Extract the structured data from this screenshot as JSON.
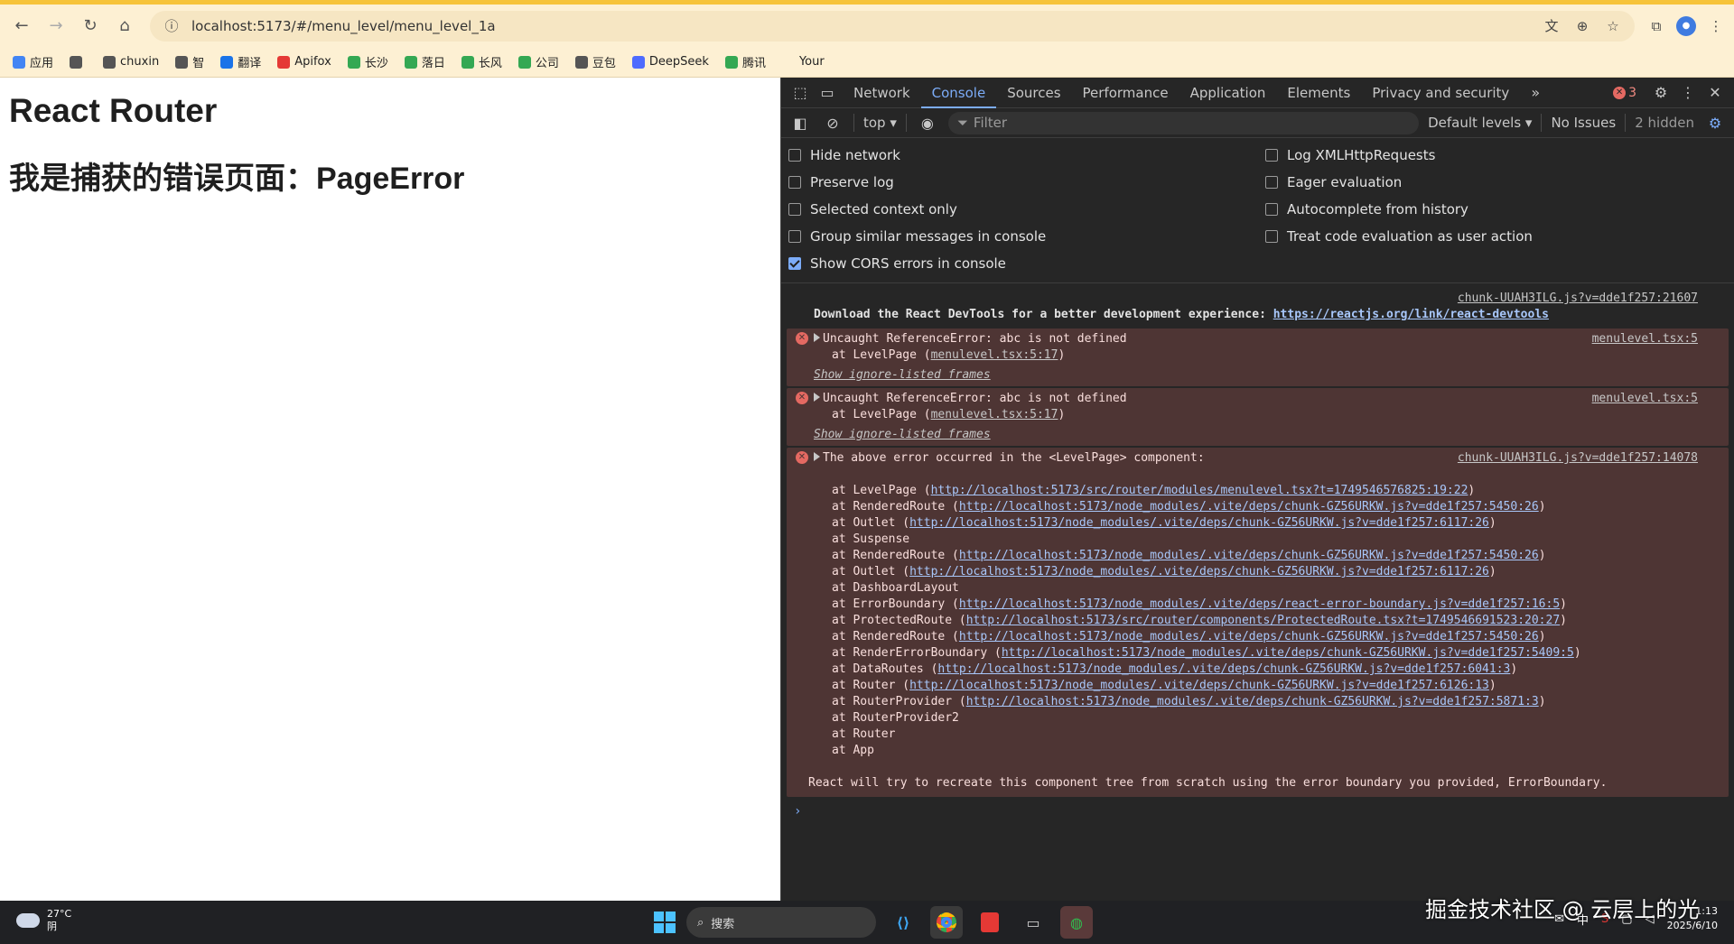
{
  "browser": {
    "url": "localhost:5173/#/menu_level/menu_level_1a",
    "bookmarks": [
      {
        "label": "应用",
        "color": "#4285f4"
      },
      {
        "label": "",
        "color": "#555555"
      },
      {
        "label": "chuxin",
        "color": "#555555"
      },
      {
        "label": "智",
        "color": "#555555"
      },
      {
        "label": "翻译",
        "color": "#1a73e8"
      },
      {
        "label": "Apifox",
        "color": "#e53935"
      },
      {
        "label": "长沙",
        "color": "#34a853"
      },
      {
        "label": "落日",
        "color": "#34a853"
      },
      {
        "label": "长风",
        "color": "#34a853"
      },
      {
        "label": "公司",
        "color": "#34a853"
      },
      {
        "label": "豆包",
        "color": "#555555"
      },
      {
        "label": "DeepSeek",
        "color": "#4d6bfe"
      },
      {
        "label": "腾讯",
        "color": "#34a853"
      },
      {
        "label": "Your",
        "color": "#fdf0d3"
      }
    ]
  },
  "page": {
    "title": "React Router",
    "subtitle": "我是捕获的错误页面：PageError"
  },
  "devtools": {
    "tabs": [
      "Network",
      "Console",
      "Sources",
      "Performance",
      "Application",
      "Elements",
      "Privacy and security"
    ],
    "active_tab": "Console",
    "error_count": "3",
    "context": "top ▾",
    "filter_placeholder": "Filter",
    "levels": "Default levels ▾",
    "issues": "No Issues",
    "hidden": "2 hidden",
    "settings_left": [
      {
        "label": "Hide network",
        "checked": false
      },
      {
        "label": "Preserve log",
        "checked": false
      },
      {
        "label": "Selected context only",
        "checked": false
      },
      {
        "label": "Group similar messages in console",
        "checked": false
      },
      {
        "label": "Show CORS errors in console",
        "checked": true
      }
    ],
    "settings_right": [
      {
        "label": "Log XMLHttpRequests",
        "checked": false
      },
      {
        "label": "Eager evaluation",
        "checked": false
      },
      {
        "label": "Autocomplete from history",
        "checked": false
      },
      {
        "label": "Treat code evaluation as user action",
        "checked": false
      }
    ],
    "info": {
      "source": "chunk-UUAH3ILG.js?v=dde1f257:21607",
      "text": "Download the React DevTools for a better development experience: ",
      "link": "https://reactjs.org/link/react-devtools"
    },
    "error1": {
      "text": "Uncaught ReferenceError: abc is not defined",
      "at_prefix": "at LevelPage (",
      "at_link": "menulevel.tsx:5:17",
      "at_suffix": ")",
      "ignore": "Show ignore-listed frames",
      "source": "menulevel.tsx:5"
    },
    "error2": {
      "text": "Uncaught ReferenceError: abc is not defined",
      "at_prefix": "at LevelPage (",
      "at_link": "menulevel.tsx:5:17",
      "at_suffix": ")",
      "ignore": "Show ignore-listed frames",
      "source": "menulevel.tsx:5"
    },
    "error3": {
      "text": "The above error occurred in the <LevelPage> component:",
      "source": "chunk-UUAH3ILG.js?v=dde1f257:14078",
      "stack": [
        {
          "prefix": "at LevelPage (",
          "link": "http://localhost:5173/src/router/modules/menulevel.tsx?t=1749546576825:19:22",
          "suffix": ")"
        },
        {
          "prefix": "at RenderedRoute (",
          "link": "http://localhost:5173/node_modules/.vite/deps/chunk-GZ56URKW.js?v=dde1f257:5450:26",
          "suffix": ")"
        },
        {
          "prefix": "at Outlet (",
          "link": "http://localhost:5173/node_modules/.vite/deps/chunk-GZ56URKW.js?v=dde1f257:6117:26",
          "suffix": ")"
        },
        {
          "prefix": "at Suspense",
          "link": "",
          "suffix": ""
        },
        {
          "prefix": "at RenderedRoute (",
          "link": "http://localhost:5173/node_modules/.vite/deps/chunk-GZ56URKW.js?v=dde1f257:5450:26",
          "suffix": ")"
        },
        {
          "prefix": "at Outlet (",
          "link": "http://localhost:5173/node_modules/.vite/deps/chunk-GZ56URKW.js?v=dde1f257:6117:26",
          "suffix": ")"
        },
        {
          "prefix": "at DashboardLayout",
          "link": "",
          "suffix": ""
        },
        {
          "prefix": "at ErrorBoundary (",
          "link": "http://localhost:5173/node_modules/.vite/deps/react-error-boundary.js?v=dde1f257:16:5",
          "suffix": ")"
        },
        {
          "prefix": "at ProtectedRoute (",
          "link": "http://localhost:5173/src/router/components/ProtectedRoute.tsx?t=1749546691523:20:27",
          "suffix": ")"
        },
        {
          "prefix": "at RenderedRoute (",
          "link": "http://localhost:5173/node_modules/.vite/deps/chunk-GZ56URKW.js?v=dde1f257:5450:26",
          "suffix": ")"
        },
        {
          "prefix": "at RenderErrorBoundary (",
          "link": "http://localhost:5173/node_modules/.vite/deps/chunk-GZ56URKW.js?v=dde1f257:5409:5",
          "suffix": ")"
        },
        {
          "prefix": "at DataRoutes (",
          "link": "http://localhost:5173/node_modules/.vite/deps/chunk-GZ56URKW.js?v=dde1f257:6041:3",
          "suffix": ")"
        },
        {
          "prefix": "at Router (",
          "link": "http://localhost:5173/node_modules/.vite/deps/chunk-GZ56URKW.js?v=dde1f257:6126:13",
          "suffix": ")"
        },
        {
          "prefix": "at RouterProvider (",
          "link": "http://localhost:5173/node_modules/.vite/deps/chunk-GZ56URKW.js?v=dde1f257:5871:3",
          "suffix": ")"
        },
        {
          "prefix": "at RouterProvider2",
          "link": "",
          "suffix": ""
        },
        {
          "prefix": "at Router",
          "link": "",
          "suffix": ""
        },
        {
          "prefix": "at App",
          "link": "",
          "suffix": ""
        }
      ],
      "footer": "React will try to recreate this component tree from scratch using the error boundary you provided, ErrorBoundary."
    }
  },
  "taskbar": {
    "temp": "27°C",
    "weather": "阴",
    "search": "搜索",
    "time": "1:13",
    "date": "2025/6/10",
    "ime": "中"
  },
  "watermark": "掘金技术社区 @ 云层上的光"
}
